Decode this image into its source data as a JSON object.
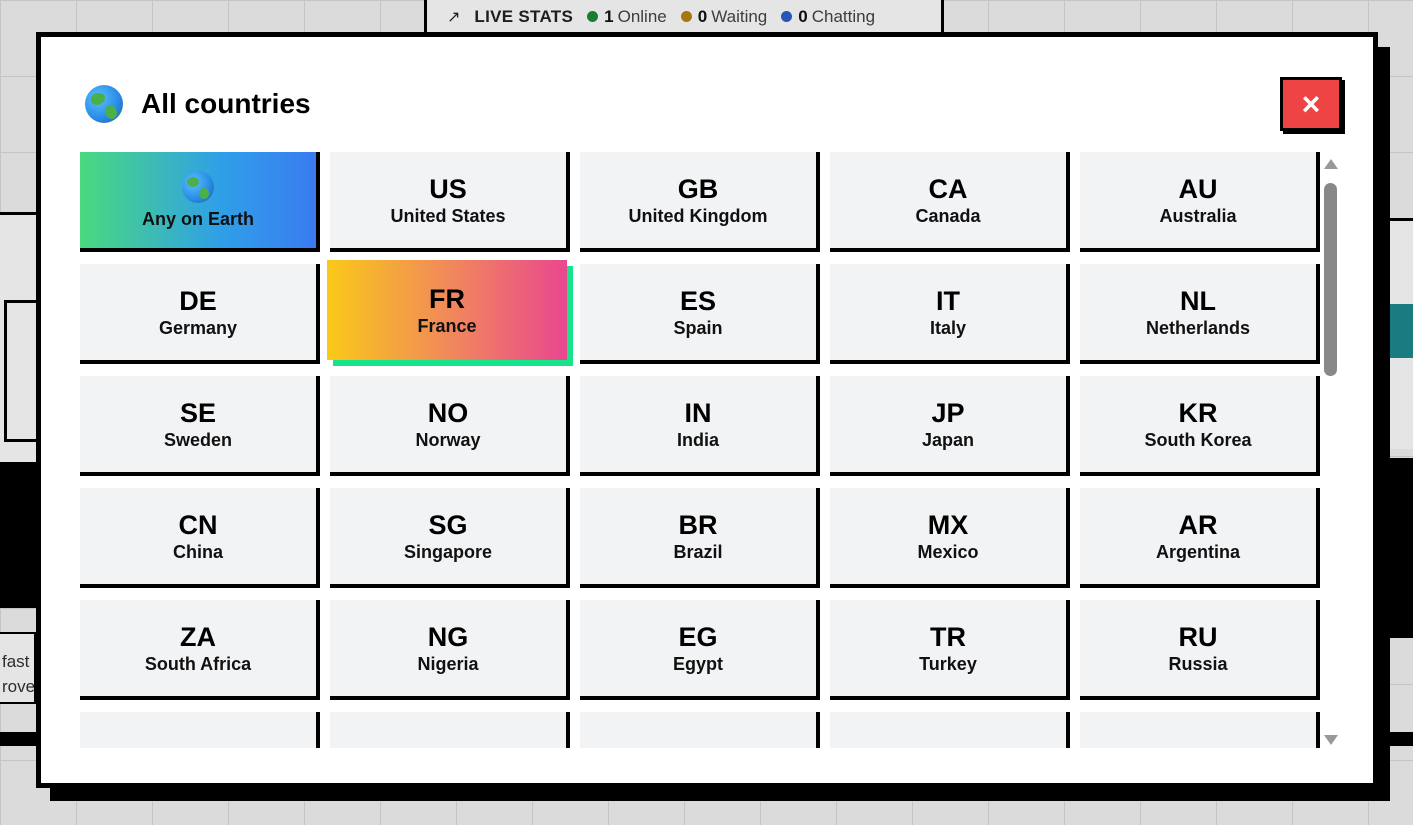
{
  "background": {
    "stats": {
      "title": "LIVE STATS",
      "trend_icon": "trending-up-icon",
      "items": [
        {
          "value": "1",
          "label": "Online",
          "color": "#1e8c3a"
        },
        {
          "value": "0",
          "label": "Waiting",
          "color": "#b8860b"
        },
        {
          "value": "0",
          "label": "Chatting",
          "color": "#2c5fcf"
        }
      ]
    },
    "left_snippet": "fast\nrove"
  },
  "modal": {
    "title": "All countries",
    "title_icon": "globe-icon",
    "close_icon": "×"
  },
  "countries": [
    {
      "code": "",
      "name": "Any on Earth",
      "variant": "any"
    },
    {
      "code": "US",
      "name": "United States"
    },
    {
      "code": "GB",
      "name": "United Kingdom"
    },
    {
      "code": "CA",
      "name": "Canada"
    },
    {
      "code": "AU",
      "name": "Australia"
    },
    {
      "code": "DE",
      "name": "Germany"
    },
    {
      "code": "FR",
      "name": "France",
      "variant": "selected"
    },
    {
      "code": "ES",
      "name": "Spain"
    },
    {
      "code": "IT",
      "name": "Italy"
    },
    {
      "code": "NL",
      "name": "Netherlands"
    },
    {
      "code": "SE",
      "name": "Sweden"
    },
    {
      "code": "NO",
      "name": "Norway"
    },
    {
      "code": "IN",
      "name": "India"
    },
    {
      "code": "JP",
      "name": "Japan"
    },
    {
      "code": "KR",
      "name": "South Korea"
    },
    {
      "code": "CN",
      "name": "China"
    },
    {
      "code": "SG",
      "name": "Singapore"
    },
    {
      "code": "BR",
      "name": "Brazil"
    },
    {
      "code": "MX",
      "name": "Mexico"
    },
    {
      "code": "AR",
      "name": "Argentina"
    },
    {
      "code": "ZA",
      "name": "South Africa"
    },
    {
      "code": "NG",
      "name": "Nigeria"
    },
    {
      "code": "EG",
      "name": "Egypt"
    },
    {
      "code": "TR",
      "name": "Turkey"
    },
    {
      "code": "RU",
      "name": "Russia"
    }
  ]
}
